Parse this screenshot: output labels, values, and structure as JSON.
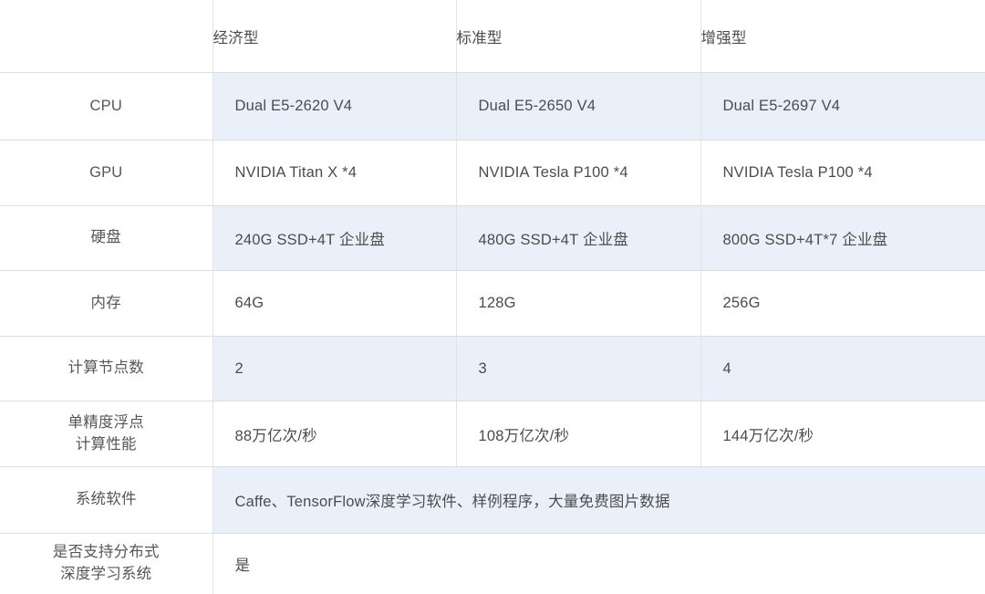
{
  "table": {
    "header": {
      "blank_label": "",
      "columns": [
        "经济型",
        "标准型",
        "增强型"
      ]
    },
    "rows": [
      {
        "label": "CPU",
        "label_line2": "",
        "shaded": true,
        "span": false,
        "values": [
          "Dual E5-2620 V4",
          "Dual E5-2650 V4",
          "Dual E5-2697 V4"
        ]
      },
      {
        "label": "GPU",
        "label_line2": "",
        "shaded": false,
        "span": false,
        "values": [
          "NVIDIA Titan X *4",
          "NVIDIA Tesla P100 *4",
          "NVIDIA Tesla P100 *4"
        ]
      },
      {
        "label": "硬盘",
        "label_line2": "",
        "shaded": true,
        "span": false,
        "values": [
          "240G SSD+4T 企业盘",
          "480G SSD+4T 企业盘",
          "800G SSD+4T*7 企业盘"
        ]
      },
      {
        "label": "内存",
        "label_line2": "",
        "shaded": false,
        "span": false,
        "values": [
          "64G",
          "128G",
          "256G"
        ]
      },
      {
        "label": "计算节点数",
        "label_line2": "",
        "shaded": true,
        "span": false,
        "values": [
          "2",
          "3",
          "4"
        ]
      },
      {
        "label": "单精度浮点",
        "label_line2": "计算性能",
        "shaded": false,
        "span": false,
        "values": [
          "88万亿次/秒",
          "108万亿次/秒",
          "144万亿次/秒"
        ]
      },
      {
        "label": "系统软件",
        "label_line2": "",
        "shaded": true,
        "span": true,
        "values": [
          "Caffe、TensorFlow深度学习软件、样例程序，大量免费图片数据"
        ]
      },
      {
        "label": "是否支持分布式",
        "label_line2": "深度学习系统",
        "shaded": false,
        "span": true,
        "values": [
          "是"
        ]
      }
    ]
  },
  "colors": {
    "shaded_cell_bg": "#eaf0f9",
    "border": "#dcdee0",
    "text": "#4c4c4c",
    "page_bg": "#ffffff"
  }
}
